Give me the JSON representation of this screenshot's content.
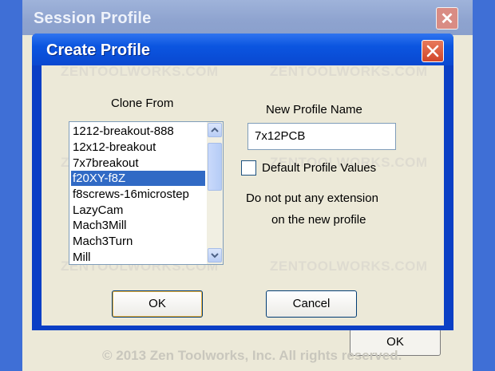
{
  "background_dialog": {
    "title": "Session Profile",
    "close_glyph": "✕",
    "ok_label": "OK",
    "copyright": "© 2013 Zen Toolworks, Inc. All rights reserved."
  },
  "dialog": {
    "title": "Create Profile",
    "close_icon": "close-icon"
  },
  "clone_from": {
    "label": "Clone From",
    "items": [
      "1212-breakout-888",
      "12x12-breakout",
      "7x7breakout",
      "f20XY-f8Z",
      "f8screws-16microstep",
      "LazyCam",
      "Mach3Mill",
      "Mach3Turn",
      "Mill"
    ],
    "selected_index": 3
  },
  "new_profile": {
    "label": "New Profile Name",
    "value": "7x12PCB"
  },
  "default_values": {
    "label": "Default Profile Values",
    "checked": false
  },
  "notice": {
    "line1": "Do not put any extension",
    "line2": "on the new profile"
  },
  "buttons": {
    "ok": "OK",
    "cancel": "Cancel"
  },
  "watermark": "ZENTOOLWORKS.COM",
  "colors": {
    "title_blue": "#0b55e0",
    "selection": "#316ac5",
    "dialog_face": "#ece9d8"
  }
}
